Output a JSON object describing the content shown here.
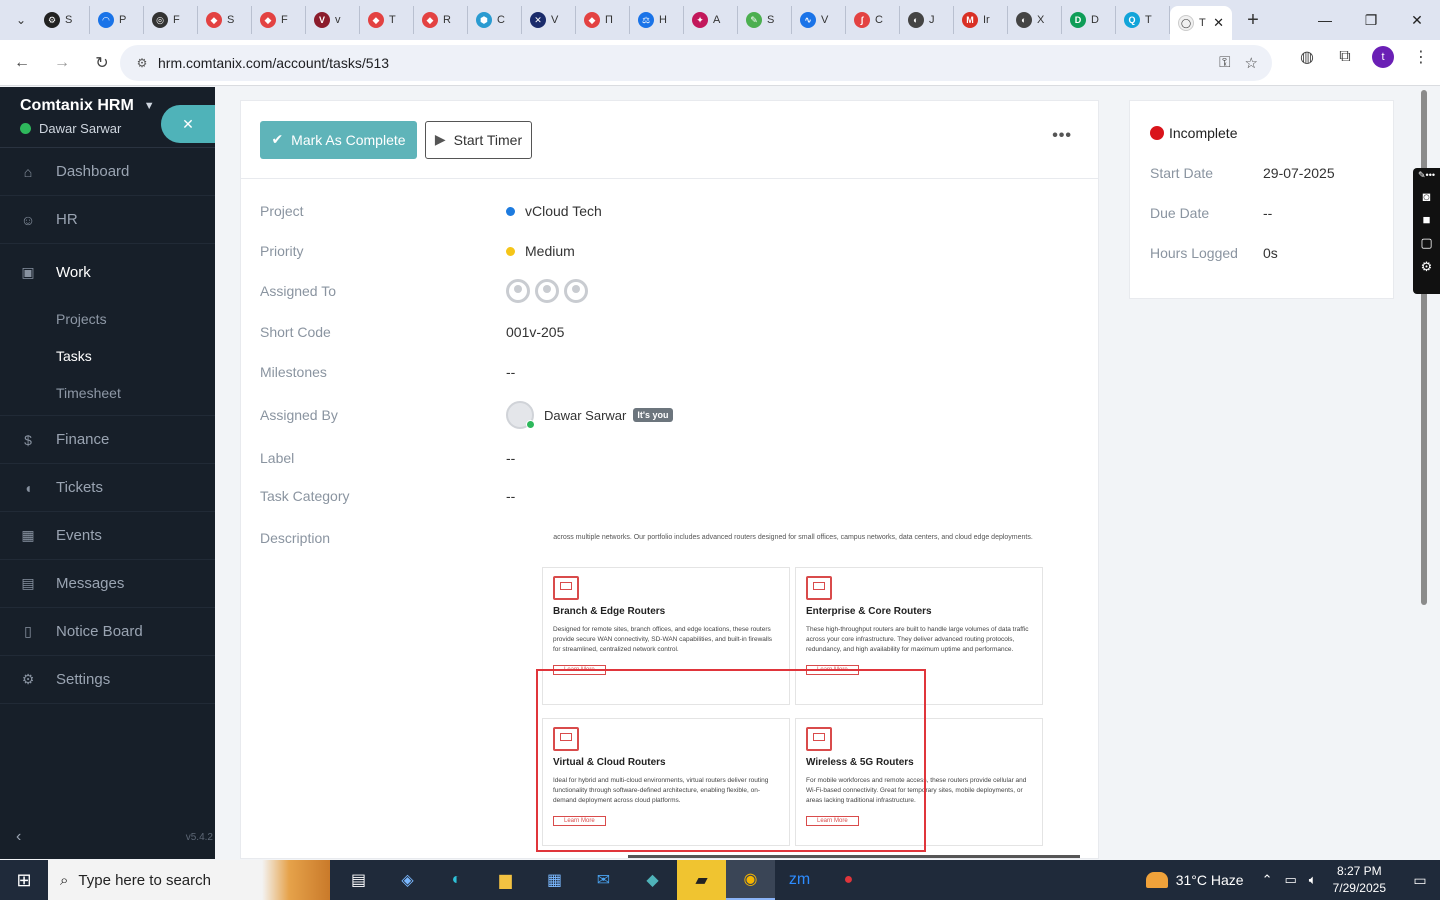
{
  "browser": {
    "tabs": [
      {
        "label": "S",
        "color": "#222222",
        "glyph": "⚙"
      },
      {
        "label": "P",
        "color": "#1a73e8",
        "glyph": "◠"
      },
      {
        "label": "F",
        "color": "#333333",
        "glyph": "◎"
      },
      {
        "label": "S",
        "color": "#e34242",
        "glyph": "◆"
      },
      {
        "label": "F",
        "color": "#e34242",
        "glyph": "◆"
      },
      {
        "label": "v",
        "color": "#8b1c2c",
        "glyph": "V"
      },
      {
        "label": "T",
        "color": "#e34242",
        "glyph": "◆"
      },
      {
        "label": "R",
        "color": "#e34242",
        "glyph": "◆"
      },
      {
        "label": "C",
        "color": "#2a9bd1",
        "glyph": "⬢"
      },
      {
        "label": "V",
        "color": "#1a2b6b",
        "glyph": "✕"
      },
      {
        "label": "П",
        "color": "#e34242",
        "glyph": "◆"
      },
      {
        "label": "H",
        "color": "#1a73e8",
        "glyph": "⚖"
      },
      {
        "label": "A",
        "color": "#c2185b",
        "glyph": "✦"
      },
      {
        "label": "S",
        "color": "#4caf50",
        "glyph": "✎"
      },
      {
        "label": "V",
        "color": "#1a73e8",
        "glyph": "∿"
      },
      {
        "label": "C",
        "color": "#e34242",
        "glyph": "∫"
      },
      {
        "label": "J",
        "color": "#444444",
        "glyph": "◐"
      },
      {
        "label": "Ir",
        "color": "#d93025",
        "glyph": "M"
      },
      {
        "label": "X",
        "color": "#444444",
        "glyph": "◐"
      },
      {
        "label": "D",
        "color": "#0f9d58",
        "glyph": "D"
      },
      {
        "label": "T",
        "color": "#12a4d9",
        "glyph": "Q"
      }
    ],
    "active_tab": {
      "label": "T"
    },
    "url": "hrm.comtanix.com/account/tasks/513"
  },
  "sidebar": {
    "brand": "Comtanix HRM",
    "user": "Dawar Sarwar",
    "menu": [
      {
        "label": "Dashboard",
        "icon": "⌂"
      },
      {
        "label": "HR",
        "icon": "☺"
      }
    ],
    "work": {
      "label": "Work",
      "icon": "▣",
      "sub": [
        "Projects",
        "Tasks",
        "Timesheet"
      ],
      "active": "Tasks"
    },
    "menu2": [
      {
        "label": "Finance",
        "icon": "$"
      },
      {
        "label": "Tickets",
        "icon": "◖"
      },
      {
        "label": "Events",
        "icon": "▦"
      },
      {
        "label": "Messages",
        "icon": "▤"
      },
      {
        "label": "Notice Board",
        "icon": "▯"
      },
      {
        "label": "Settings",
        "icon": "⚙"
      }
    ],
    "version": "v5.4.2"
  },
  "task": {
    "complete_btn": "Mark As Complete",
    "timer_btn": "Start Timer",
    "fields": {
      "project": {
        "label": "Project",
        "value": "vCloud Tech",
        "color": "#1d7bdf"
      },
      "priority": {
        "label": "Priority",
        "value": "Medium",
        "color": "#f5c518"
      },
      "assigned_to": {
        "label": "Assigned To"
      },
      "short_code": {
        "label": "Short Code",
        "value": "001v-205"
      },
      "milestones": {
        "label": "Milestones",
        "value": "--"
      },
      "assigned_by": {
        "label": "Assigned By",
        "value": "Dawar Sarwar",
        "badge": "It's you"
      },
      "label": {
        "label": "Label",
        "value": "--"
      },
      "task_category": {
        "label": "Task Category",
        "value": "--"
      },
      "description": {
        "label": "Description"
      }
    },
    "description_image": {
      "intro": "across multiple networks. Our portfolio includes advanced routers designed for small offices, campus networks, data centers, and cloud edge deployments.",
      "cards": [
        {
          "title": "Branch & Edge Routers",
          "text": "Designed for remote sites, branch offices, and edge locations, these routers provide secure WAN connectivity, SD-WAN capabilities, and built-in firewalls for streamlined, centralized network control.",
          "link": "Learn More"
        },
        {
          "title": "Enterprise & Core Routers",
          "text": "These high-throughput routers are built to handle large volumes of data traffic across your core infrastructure. They deliver advanced routing protocols, redundancy, and high availability for maximum uptime and performance.",
          "link": "Learn More"
        },
        {
          "title": "Virtual & Cloud Routers",
          "text": "Ideal for hybrid and multi-cloud environments, virtual routers deliver routing functionality through software-defined architecture, enabling flexible, on-demand deployment across cloud platforms.",
          "link": "Learn More"
        },
        {
          "title": "Wireless & 5G Routers",
          "text": "For mobile workforces and remote access, these routers provide cellular and Wi-Fi-based connectivity. Great for temporary sites, mobile deployments, or areas lacking traditional infrastructure.",
          "link": "Learn More"
        }
      ]
    }
  },
  "status_card": {
    "status": "Incomplete",
    "status_color": "#d9141b",
    "rows": [
      {
        "label": "Start Date",
        "value": "29-07-2025"
      },
      {
        "label": "Due Date",
        "value": "--"
      },
      {
        "label": "Hours Logged",
        "value": "0s"
      }
    ]
  },
  "taskbar": {
    "search_placeholder": "Type here to search",
    "weather": "31°C  Haze",
    "time": "8:27 PM",
    "date": "7/29/2025"
  }
}
